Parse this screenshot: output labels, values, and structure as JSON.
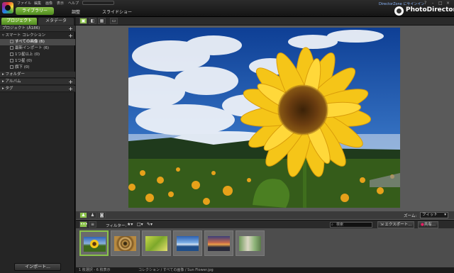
{
  "menubar": {
    "items": [
      "ファイル",
      "編集",
      "画像",
      "表示",
      "ヘルプ"
    ]
  },
  "modes": {
    "library": "ライブラリー",
    "adjust": "調整",
    "slideshow": "スライドショー"
  },
  "window": {
    "signin": "DirectorZone にサインイン",
    "help": "?",
    "minimize": "-",
    "maximize": "□",
    "close": "×"
  },
  "brand": {
    "name": "PhotoDirector"
  },
  "left_panel": {
    "tabs": [
      "プロジェクト",
      "メタデータ"
    ],
    "project_header": "プロジェクト (Å186)",
    "smart_collection": "スマート コレクション",
    "smart_items": [
      "すべての画像 (6)",
      "最新インポート (6)",
      "1つ星以上 (0)",
      "1つ星 (0)",
      "旗下 (0)"
    ],
    "folder": "フォルダー",
    "album": "アルバム",
    "tags": "タグ",
    "import_button": "インポート..."
  },
  "viewer": {
    "zoom_label": "ズーム:",
    "zoom_value": "フィット"
  },
  "filmstrip": {
    "filter_label": "フィルター:",
    "search_placeholder": "検索",
    "export_button": "エクスポート...",
    "share_button": "共有..."
  },
  "status": {
    "selection": "1 枚選択 - 6 枚表示",
    "path": "コレクション / すべての画像 / Sun Flower.jpg"
  },
  "colors": {
    "accent": "#8bc34a",
    "sky": "#1a4fa6",
    "petal": "#f5c518"
  }
}
